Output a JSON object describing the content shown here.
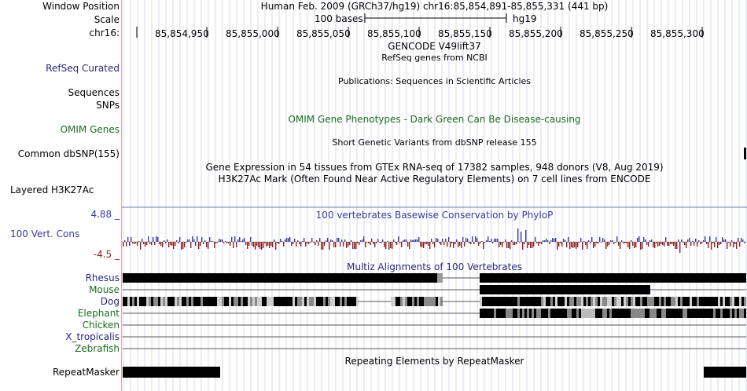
{
  "header": {
    "window_position_label": "Window Position",
    "window_position_text": "Human Feb. 2009 (GRCh37/hg19)   chr16:85,854,891-85,855,331 (441 bp)",
    "scale_label": "Scale",
    "scale_text": "100 bases",
    "scale_assembly": "hg19",
    "chrom_label": "chr16:",
    "ruler_ticks": [
      "85,854,950",
      "85,855,000",
      "85,855,050",
      "85,855,100",
      "85,855,150",
      "85,855,200",
      "85,855,250",
      "85,855,300"
    ]
  },
  "tracks": {
    "gencode_title": "GENCODE V49lift37",
    "refseq_subtitle": "RefSeq genes from NCBI",
    "refseq_label": "RefSeq Curated",
    "publications_title": "Publications: Sequences in Scientific Articles",
    "sequences_label": "Sequences",
    "snps_label": "SNPs",
    "omim_title": "OMIM Gene Phenotypes - Dark Green Can Be Disease-causing",
    "omim_label": "OMIM Genes",
    "dbsnp_title": "Short Genetic Variants from dbSNP release 155",
    "dbsnp_label": "Common dbSNP(155)",
    "gtex_title": "Gene Expression in 54 tissues from GTEx RNA-seq of 17382 samples, 948 donors (V8, Aug 2019)",
    "h3k27ac_title": "H3K27Ac Mark (Often Found Near Active Regulatory Elements) on 7 cell lines from ENCODE",
    "h3k27ac_label": "Layered H3K27Ac",
    "phylop_title": "100 vertebrates Basewise Conservation by PhyloP",
    "phylop_max": "4.88 _",
    "phylop_min": "-4.5 _",
    "cons_label": "100 Vert. Cons",
    "multiz_title": "Multiz Alignments of 100 Vertebrates",
    "species": [
      "Rhesus",
      "Mouse",
      "Dog",
      "Elephant",
      "Chicken",
      "X_tropicalis",
      "Zebrafish"
    ],
    "repeat_title": "Repeating Elements by RepeatMasker",
    "repeat_label": "RepeatMasker"
  },
  "colors": {
    "label_blue": "#28287a",
    "label_green": "#1d6b1d",
    "conservation_pos": "#3a3aa0",
    "conservation_neg": "#8a2020",
    "divider": "#e8a0a0",
    "grid": "#d8d8f0"
  }
}
